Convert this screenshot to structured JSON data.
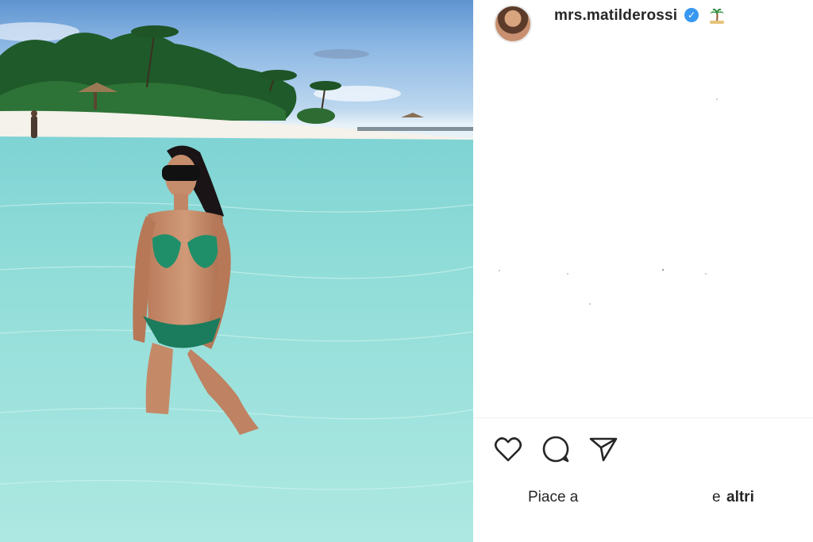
{
  "post": {
    "username": "mrs.matilderossi",
    "verified_icon": "verified-badge-icon",
    "location_emoji": "palm-tree-emoji"
  },
  "actions": {
    "like_icon": "heart-icon",
    "comment_icon": "comment-bubble-icon",
    "share_icon": "paper-plane-icon"
  },
  "likes": {
    "prefix": "Piace a",
    "connector": "e",
    "others": "altri"
  },
  "colors": {
    "text": "#262626",
    "verified": "#3897f0",
    "water": "#8fdcd8",
    "sky": "#6fa3d9"
  }
}
